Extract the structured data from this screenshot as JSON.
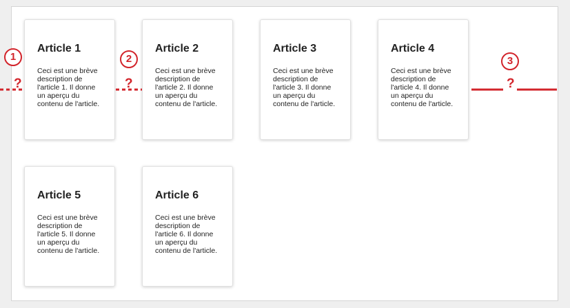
{
  "cards": [
    {
      "title": "Article 1",
      "desc": "Ceci est une brève description de l'article 1. Il donne un aperçu du contenu de l'article."
    },
    {
      "title": "Article 2",
      "desc": "Ceci est une brève description de l'article 2. Il donne un aperçu du contenu de l'article."
    },
    {
      "title": "Article 3",
      "desc": "Ceci est une brève description de l'article 3. Il donne un aperçu du contenu de l'article."
    },
    {
      "title": "Article 4",
      "desc": "Ceci est une brève description de l'article 4. Il donne un aperçu du contenu de l'article."
    },
    {
      "title": "Article 5",
      "desc": "Ceci est une brève description de l'article 5. Il donne un aperçu du contenu de l'article."
    },
    {
      "title": "Article 6",
      "desc": "Ceci est une brève description de l'article 6. Il donne un aperçu du contenu de l'article."
    }
  ],
  "annotations": [
    {
      "badge": "1",
      "mark": "?"
    },
    {
      "badge": "2",
      "mark": "?"
    },
    {
      "badge": "3",
      "mark": "?"
    }
  ],
  "colors": {
    "accent": "#d2232a"
  }
}
